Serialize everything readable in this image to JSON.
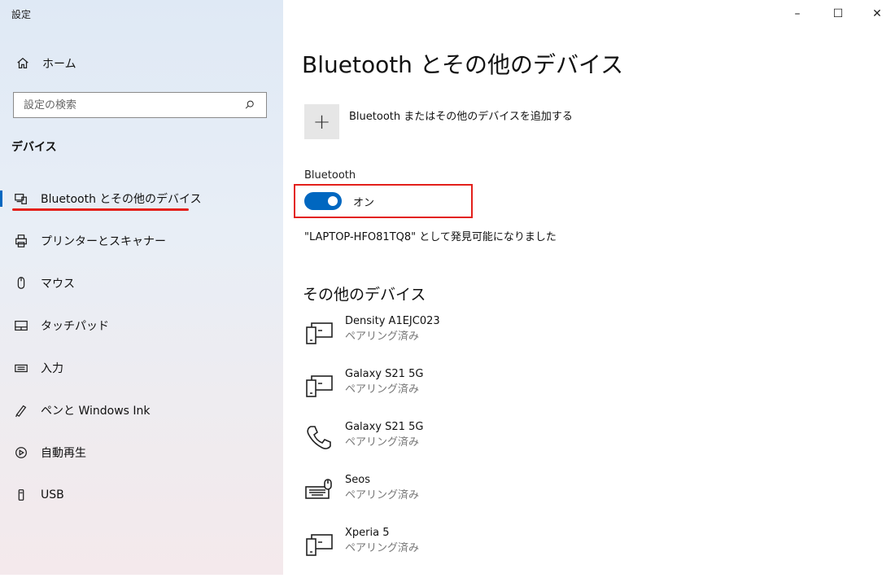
{
  "app_title": "設定",
  "window_controls": {
    "minimize": "–",
    "maximize": "☐",
    "close": "✕"
  },
  "sidebar": {
    "home_label": "ホーム",
    "search_placeholder": "設定の検索",
    "section_heading": "デバイス",
    "items": [
      {
        "label": "Bluetooth とその他のデバイス",
        "icon": "devices-icon",
        "selected": true
      },
      {
        "label": "プリンターとスキャナー",
        "icon": "printer-icon"
      },
      {
        "label": "マウス",
        "icon": "mouse-icon"
      },
      {
        "label": "タッチパッド",
        "icon": "touchpad-icon"
      },
      {
        "label": "入力",
        "icon": "keyboard-icon"
      },
      {
        "label": "ペンと Windows Ink",
        "icon": "pen-icon"
      },
      {
        "label": "自動再生",
        "icon": "autoplay-icon"
      },
      {
        "label": "USB",
        "icon": "usb-icon"
      }
    ]
  },
  "main": {
    "title": "Bluetooth とその他のデバイス",
    "add_device_label": "Bluetooth またはその他のデバイスを追加する",
    "bluetooth_label": "Bluetooth",
    "toggle_state": "オン",
    "discoverable_text": "\"LAPTOP-HFO81TQ8\" として発見可能になりました",
    "other_devices_heading": "その他のデバイス",
    "devices": [
      {
        "name": "Density A1EJC023",
        "status": "ペアリング済み",
        "icon": "device-icon"
      },
      {
        "name": "Galaxy S21 5G",
        "status": "ペアリング済み",
        "icon": "device-icon"
      },
      {
        "name": "Galaxy S21 5G",
        "status": "ペアリング済み",
        "icon": "phone-icon"
      },
      {
        "name": "Seos",
        "status": "ペアリング済み",
        "icon": "keyboard-mouse-icon"
      },
      {
        "name": "Xperia 5",
        "status": "ペアリング済み",
        "icon": "device-icon"
      }
    ]
  },
  "colors": {
    "accent": "#0067c0",
    "highlight": "#e3201b"
  }
}
